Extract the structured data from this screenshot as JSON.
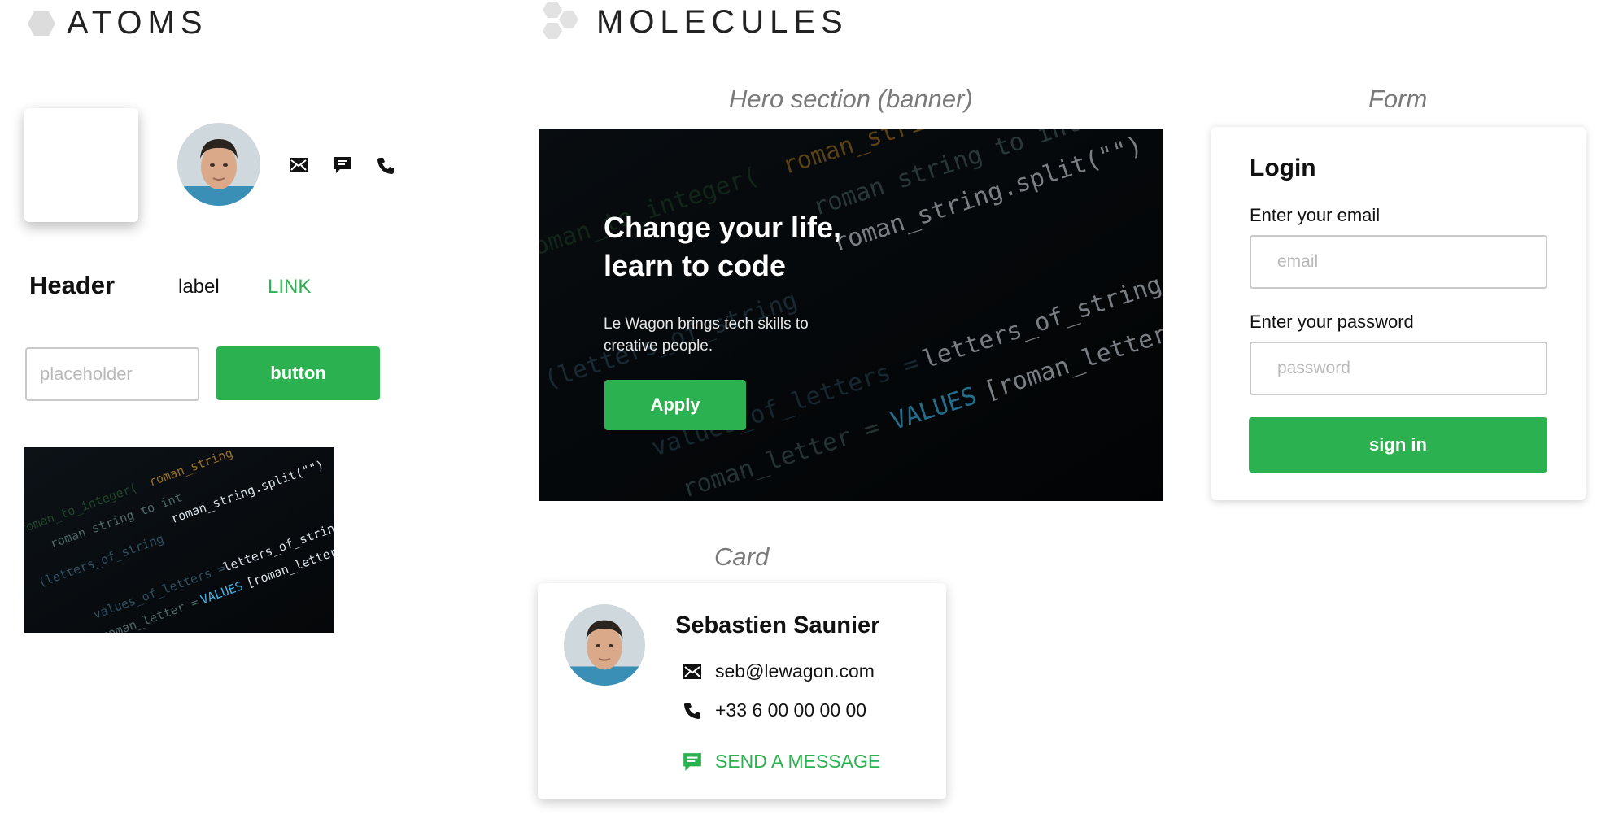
{
  "atoms": {
    "title": "ATOMS",
    "header_text": "Header",
    "label_text": "label",
    "link_text": "LINK",
    "input_placeholder": "placeholder",
    "button_label": "button"
  },
  "molecules": {
    "title": "MOLECULES",
    "hero_caption": "Hero section (banner)",
    "form_caption": "Form",
    "card_caption": "Card"
  },
  "hero": {
    "title": "Change your life, learn to code",
    "subtitle": "Le Wagon brings tech skills to creative people.",
    "button_label": "Apply"
  },
  "form": {
    "title": "Login",
    "email_label": "Enter your email",
    "email_placeholder": "email",
    "password_label": "Enter your password",
    "password_placeholder": "password",
    "submit_label": "sign in"
  },
  "card": {
    "name": "Sebastien Saunier",
    "email": "seb@lewagon.com",
    "phone": "+33 6 00 00 00 00",
    "message_link": "SEND A MESSAGE"
  },
  "colors": {
    "accent_green": "#2bb14f",
    "caption_gray": "#7a7a7a",
    "code_bg": "#070a0d"
  },
  "icons": [
    "hexagon-icon",
    "molecule-icon",
    "mail-icon",
    "chat-icon",
    "phone-icon"
  ]
}
